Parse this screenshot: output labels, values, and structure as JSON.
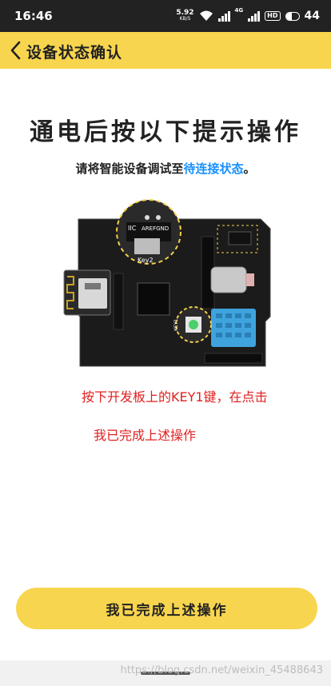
{
  "status_bar": {
    "time": "16:46",
    "net_speed_value": "5.92",
    "net_speed_unit": "KB/S",
    "network_label": "4G",
    "hd_label": "HD",
    "battery_level": "44"
  },
  "header": {
    "back_icon": "chevron-left-icon",
    "title": "设备状态确认"
  },
  "content": {
    "main_title": "通电后按以下提示操作",
    "subtitle_prefix": "请将智能设备调试至",
    "subtitle_highlight": "待连接状态",
    "subtitle_suffix": "。",
    "board_labels": {
      "iic": "IIC",
      "arefgnd": "AREFGND",
      "key2": "Key2",
      "key1": "KEY1"
    },
    "instruction_line1": "按下开发板上的KEY1键，在点击",
    "instruction_line2": "我已完成上述操作"
  },
  "button": {
    "label": "我已完成上述操作"
  },
  "footer": {
    "watermark": "https://blog.csdn.net/weixin_45488643"
  },
  "colors": {
    "accent_yellow": "#f8d54e",
    "highlight_blue": "#1890ff",
    "instruction_red": "#e02020"
  }
}
